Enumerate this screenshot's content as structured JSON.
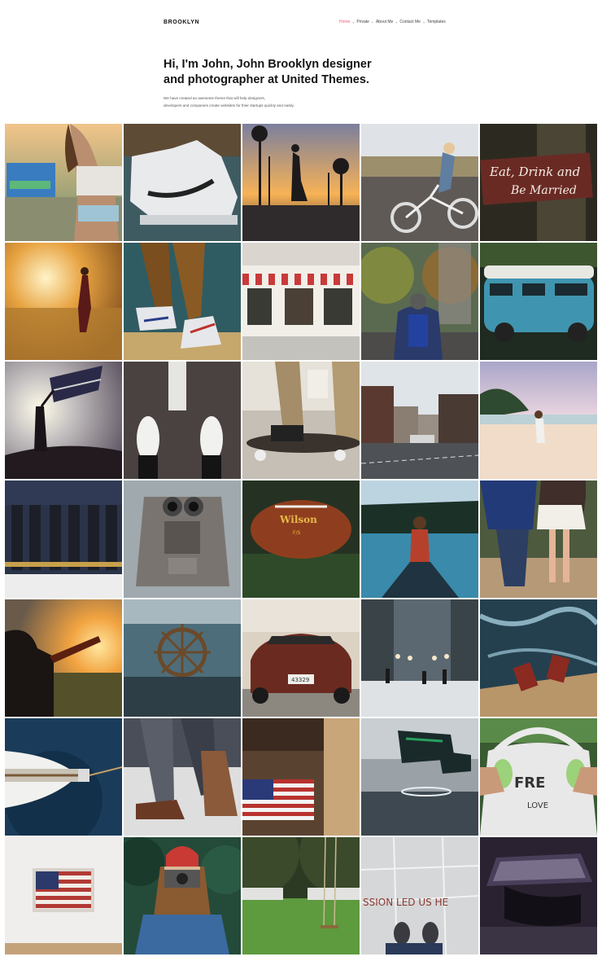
{
  "header": {
    "logo": "BROOKLYN",
    "nav": [
      {
        "label": "Home",
        "active": true
      },
      {
        "label": "Private"
      },
      {
        "label": "About Me"
      },
      {
        "label": "Contact Me"
      },
      {
        "label": "Templates"
      }
    ],
    "accent_color": "#ef5b7a"
  },
  "hero": {
    "title_line1": "Hi, I'm John, John Brooklyn designer",
    "title_line2": "and photographer at United Themes.",
    "subtitle_line1": "We have created an awesome theme that will help designers,",
    "subtitle_line2": "developers and companies create websites for their startups quickly and easily."
  },
  "gallery": {
    "sign_text_1": "Eat, Drink and",
    "sign_text_2": "Be Married",
    "ball_brand": "Wilson",
    "ball_model": "F/S",
    "plate_text": "43329",
    "shirt_text": "FRE",
    "shirt_text_2": "LOVE",
    "floor_text": "SSION LED US HE"
  }
}
